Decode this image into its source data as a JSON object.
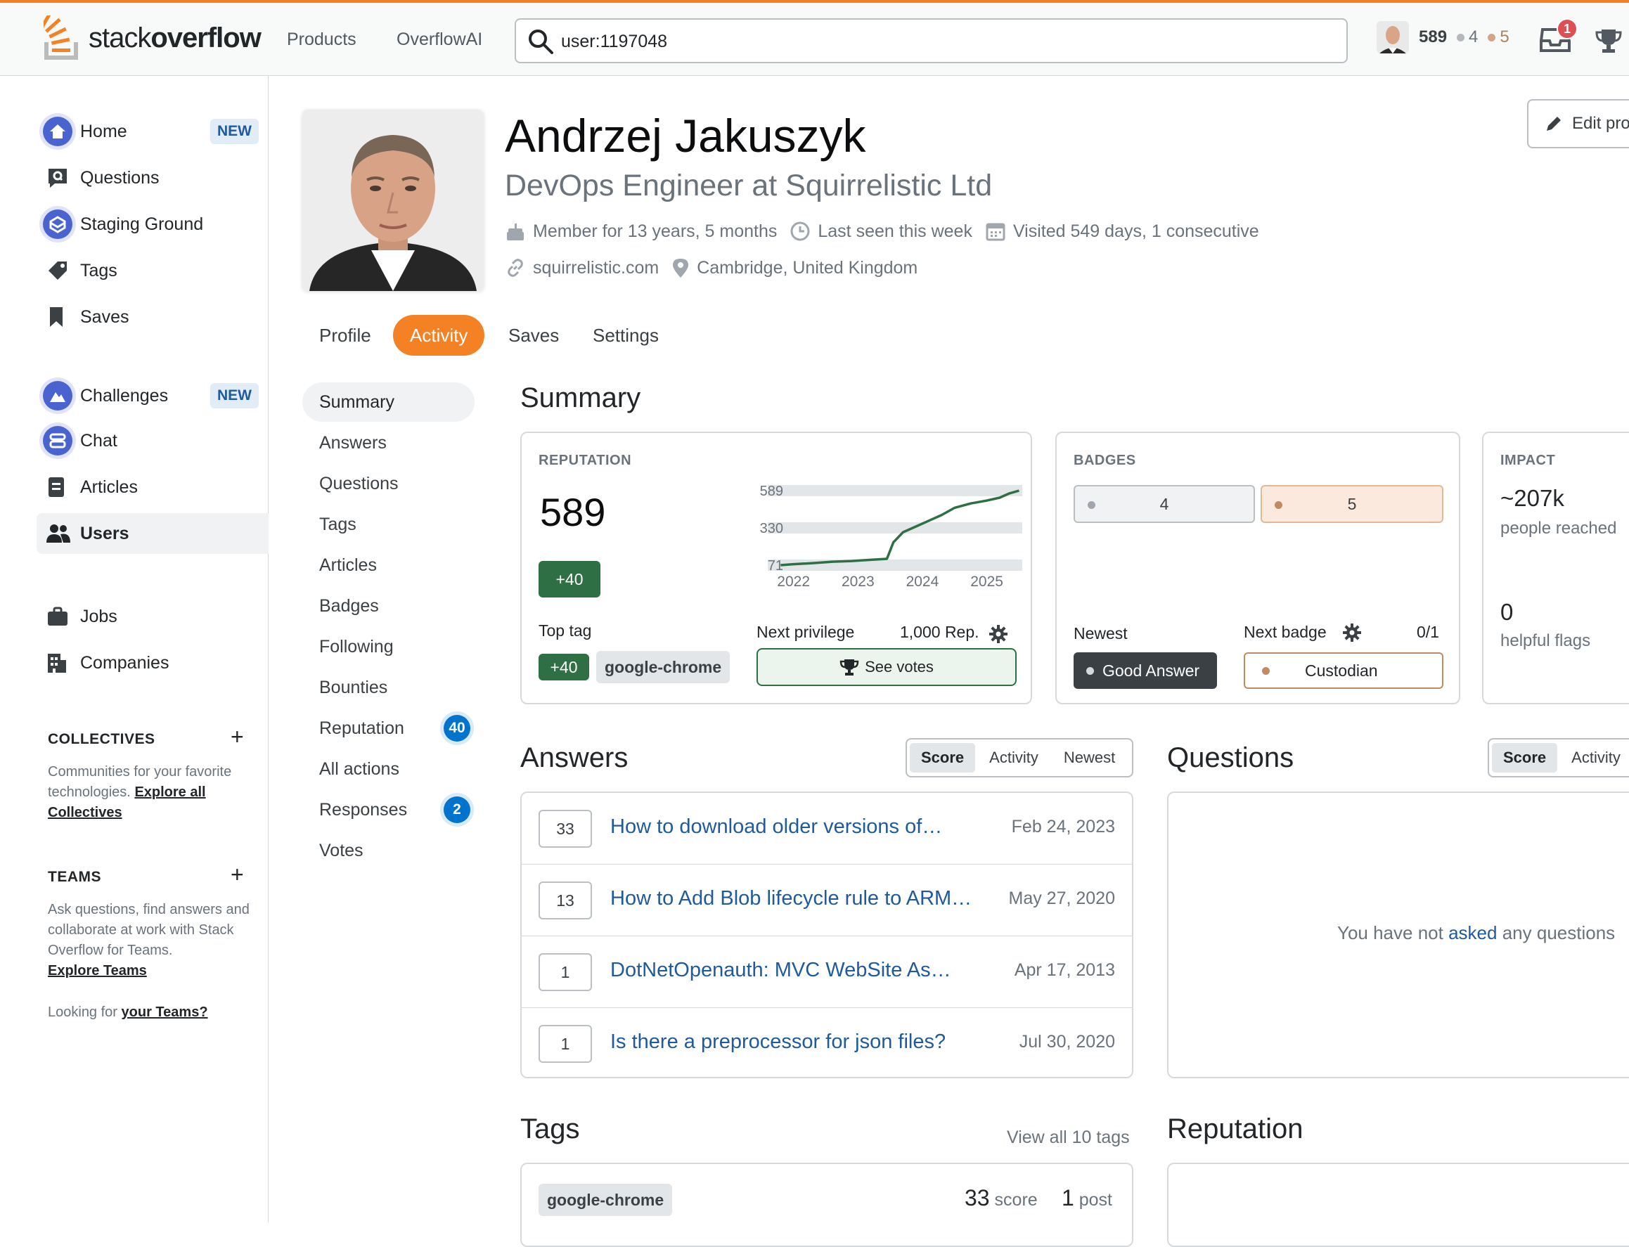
{
  "topbar": {
    "logo_light": "stack",
    "logo_bold": "overflow",
    "nav": [
      "Products",
      "OverflowAI"
    ],
    "search_value": "user:1197048",
    "reputation": "589",
    "silver_badges": "4",
    "bronze_badges": "5",
    "inbox_count": "1",
    "accent_color": "#f48225"
  },
  "sidebar": {
    "items": [
      {
        "label": "Home",
        "icon": "home-icon",
        "pill": "NEW"
      },
      {
        "label": "Questions",
        "icon": "questions-icon"
      },
      {
        "label": "Staging Ground",
        "icon": "staging-ground-icon"
      },
      {
        "label": "Tags",
        "icon": "tag-icon"
      },
      {
        "label": "Saves",
        "icon": "bookmark-icon"
      },
      {
        "label": "Challenges",
        "icon": "challenges-icon",
        "pill": "NEW"
      },
      {
        "label": "Chat",
        "icon": "chat-icon"
      },
      {
        "label": "Articles",
        "icon": "articles-icon"
      },
      {
        "label": "Users",
        "icon": "users-icon"
      },
      {
        "label": "Jobs",
        "icon": "jobs-icon"
      },
      {
        "label": "Companies",
        "icon": "companies-icon"
      }
    ],
    "collectives": {
      "heading": "COLLECTIVES",
      "desc": "Communities for your favorite technologies.",
      "link": "Explore all Collectives"
    },
    "teams": {
      "heading": "TEAMS",
      "desc": "Ask questions, find answers and collaborate at work with Stack Overflow for Teams.",
      "link": "Explore Teams",
      "looking_prefix": "Looking for",
      "looking_link": "your Teams?"
    }
  },
  "profile": {
    "name": "Andrzej Jakuszyk",
    "title": "DevOps Engineer at Squirrelistic Ltd",
    "member_for": "Member for 13 years, 5 months",
    "last_seen": "Last seen this week",
    "visited": "Visited 549 days, 1 consecutive",
    "website": "squirrelistic.com",
    "location": "Cambridge, United Kingdom",
    "edit_label": "Edit pro"
  },
  "tabs": [
    "Profile",
    "Activity",
    "Saves",
    "Settings"
  ],
  "activity_nav": [
    {
      "label": "Summary"
    },
    {
      "label": "Answers"
    },
    {
      "label": "Questions"
    },
    {
      "label": "Tags"
    },
    {
      "label": "Articles"
    },
    {
      "label": "Badges"
    },
    {
      "label": "Following"
    },
    {
      "label": "Bounties"
    },
    {
      "label": "Reputation",
      "count": "40"
    },
    {
      "label": "All actions"
    },
    {
      "label": "Responses",
      "count": "2"
    },
    {
      "label": "Votes"
    }
  ],
  "summary": {
    "title": "Summary",
    "reputation": {
      "label": "REPUTATION",
      "value": "589",
      "gain": "+40",
      "top_tag_label": "Top tag",
      "top_tag_gain": "+40",
      "top_tag": "google-chrome",
      "next_privilege_label": "Next privilege",
      "next_privilege_value": "1,000 Rep.",
      "see_votes": "See votes"
    },
    "badges": {
      "label": "BADGES",
      "silver": "4",
      "bronze": "5",
      "newest_label": "Newest",
      "newest": "Good Answer",
      "next_label": "Next badge",
      "next_progress": "0/1",
      "next": "Custodian"
    },
    "impact": {
      "label": "IMPACT",
      "reached": "~207k",
      "reached_label": "people reached",
      "flags": "0",
      "flags_label": "helpful flags"
    }
  },
  "chart_data": {
    "type": "line",
    "title": "",
    "y_ticks": [
      "589",
      "330",
      "71"
    ],
    "x_ticks": [
      "2022",
      "2023",
      "2024",
      "2025"
    ],
    "ylim": [
      71,
      589
    ],
    "series": [
      {
        "color": "#2f6f44",
        "x": [
          2021.8,
          2022.0,
          2022.3,
          2022.6,
          2022.9,
          2023.2,
          2023.45,
          2023.55,
          2023.7,
          2023.9,
          2024.1,
          2024.3,
          2024.5,
          2024.75,
          2025.0,
          2025.2,
          2025.35,
          2025.5
        ],
        "values": [
          71,
          78,
          85,
          95,
          100,
          108,
          115,
          230,
          300,
          340,
          380,
          420,
          470,
          500,
          520,
          540,
          570,
          589
        ]
      }
    ]
  },
  "answers": {
    "title": "Answers",
    "sort": [
      "Score",
      "Activity",
      "Newest"
    ],
    "rows": [
      {
        "score": "33",
        "title": "How to download older versions of…",
        "date": "Feb 24, 2023"
      },
      {
        "score": "13",
        "title": "How to Add Blob lifecycle rule to ARM…",
        "date": "May 27, 2020"
      },
      {
        "score": "1",
        "title": "DotNetOpenauth: MVC WebSite As…",
        "date": "Apr 17, 2013"
      },
      {
        "score": "1",
        "title": "Is there a preprocessor for json files?",
        "date": "Jul 30, 2020"
      }
    ]
  },
  "questions": {
    "title": "Questions",
    "sort": [
      "Score",
      "Activity"
    ],
    "empty_prefix": "You have not",
    "empty_link": "asked",
    "empty_suffix": "any questions"
  },
  "tags": {
    "title": "Tags",
    "view_all": "View all 10 tags",
    "rows": [
      {
        "tag": "google-chrome",
        "score": "33",
        "score_label": "score",
        "posts": "1",
        "posts_label": "post"
      }
    ]
  },
  "reputation_section": {
    "title": "Reputation"
  }
}
